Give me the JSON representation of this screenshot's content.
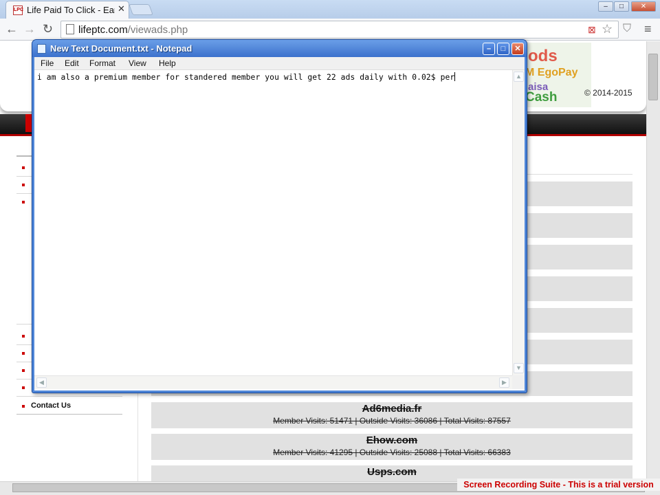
{
  "browser": {
    "tab_title": "Life Paid To Click - Ear",
    "tab_favicon": "LPC",
    "url_host": "lifeptc.com",
    "url_path": "/viewads.php",
    "window_buttons": [
      "–",
      "□",
      "✕"
    ]
  },
  "page": {
    "banner_lines": [
      "ods",
      "M EgoPay",
      "aisa",
      "Cash"
    ],
    "copyright": "© 2014-2015",
    "sidebar_contact": "Contact Us",
    "ads": [
      {
        "name": "Ad6media.fr",
        "stats": "Member Visits: 51471 | Outside Visits: 36086 | Total Visits: 87557"
      },
      {
        "name": "Ehow.com",
        "stats": "Member Visits: 41295 | Outside Visits: 25088 | Total Visits: 66383"
      },
      {
        "name": "Usps.com",
        "stats": ""
      }
    ]
  },
  "notepad": {
    "title": "New Text Document.txt - Notepad",
    "menu": [
      "File",
      "Edit",
      "Format",
      "View",
      "Help"
    ],
    "text": "i am also a premium member for standered member you will get 22 ads daily with 0.02$ per"
  },
  "watermark": "Screen Recording Suite - This is a trial version",
  "colors": {
    "accent_red": "#cc0000",
    "notepad_frame": "#4f86d8"
  }
}
